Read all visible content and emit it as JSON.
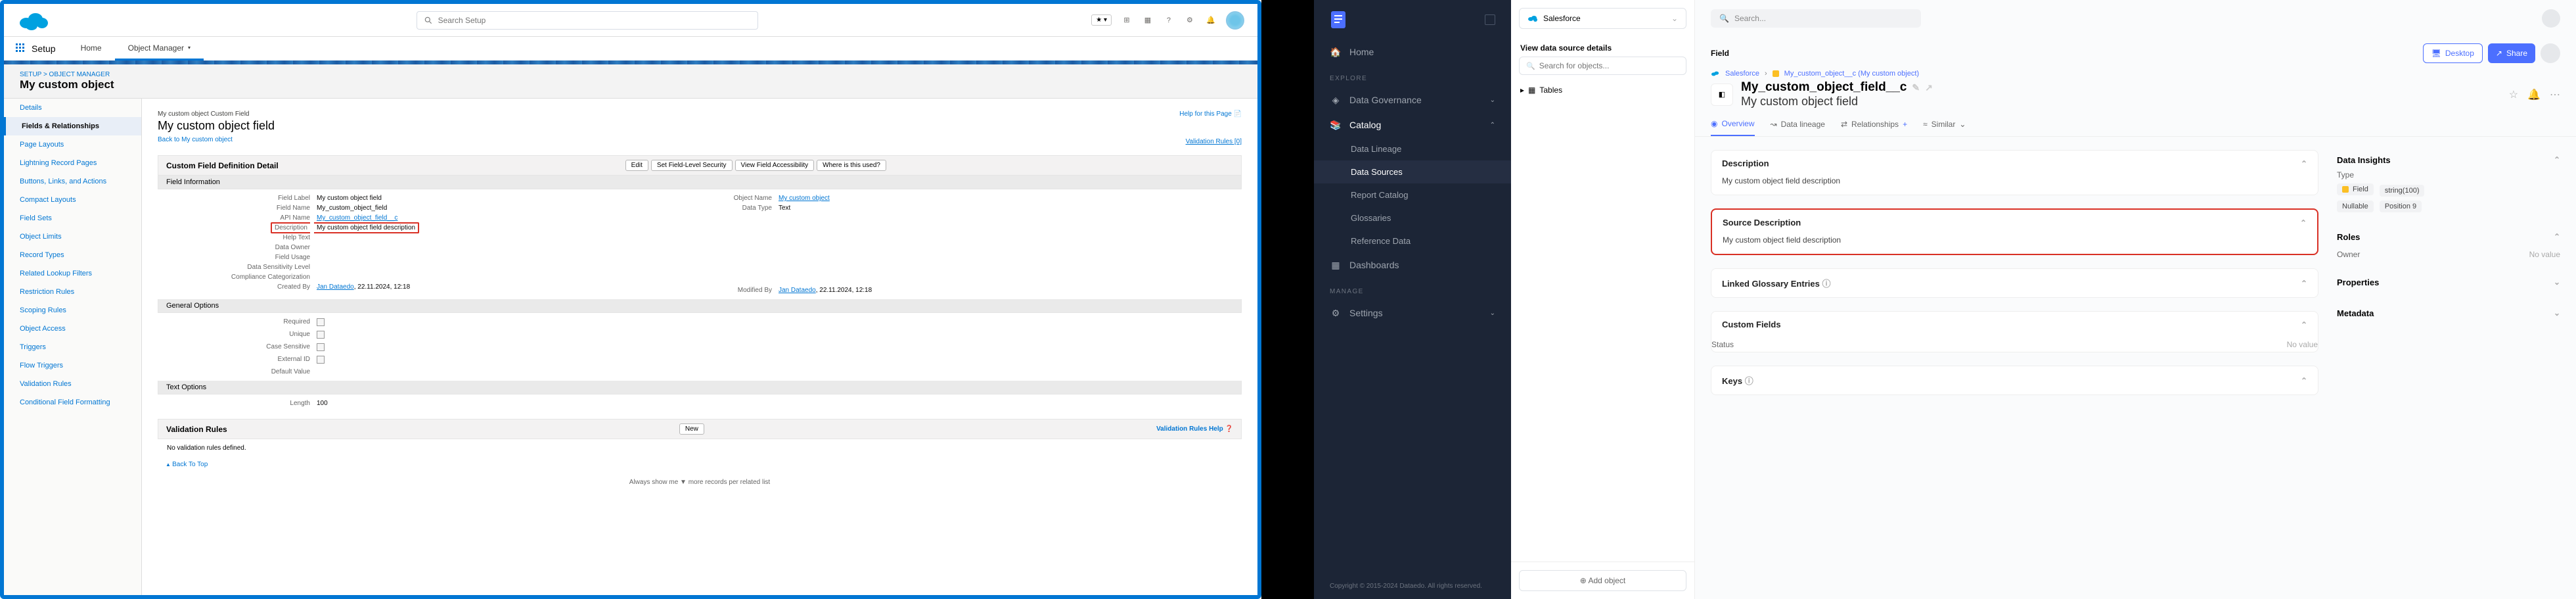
{
  "sf": {
    "search_placeholder": "Search Setup",
    "app_name": "Setup",
    "tab_home": "Home",
    "tab_obj": "Object Manager",
    "crumb": "SETUP  >  OBJECT MANAGER",
    "obj_name": "My custom object",
    "sidebar": [
      "Details",
      "Fields & Relationships",
      "Page Layouts",
      "Lightning Record Pages",
      "Buttons, Links, and Actions",
      "Compact Layouts",
      "Field Sets",
      "Object Limits",
      "Record Types",
      "Related Lookup Filters",
      "Restriction Rules",
      "Scoping Rules",
      "Object Access",
      "Triggers",
      "Flow Triggers",
      "Validation Rules",
      "Conditional Field Formatting"
    ],
    "bread2": "My custom object Custom Field",
    "h1": "My custom object field",
    "back": "Back to My custom object",
    "valid_link": "Validation Rules [0]",
    "help": "Help for this Page",
    "block1_title": "Custom Field Definition Detail",
    "btns": [
      "Edit",
      "Set Field-Level Security",
      "View Field Accessibility",
      "Where is this used?"
    ],
    "sub1": "Field Information",
    "rows_left": {
      "field_label": {
        "lbl": "Field Label",
        "val": "My custom object field"
      },
      "field_name": {
        "lbl": "Field Name",
        "val": "My_custom_object_field"
      },
      "api_name": {
        "lbl": "API Name",
        "val": "My_custom_object_field__c"
      },
      "description": {
        "lbl": "Description",
        "val": "My custom object field description"
      },
      "help_text": {
        "lbl": "Help Text",
        "val": ""
      },
      "data_owner": {
        "lbl": "Data Owner",
        "val": ""
      },
      "field_usage": {
        "lbl": "Field Usage",
        "val": ""
      },
      "data_sens": {
        "lbl": "Data Sensitivity Level",
        "val": ""
      },
      "compliance": {
        "lbl": "Compliance Categorization",
        "val": ""
      },
      "created_by": {
        "lbl": "Created By",
        "val": "Jan Dataedo",
        "date": ", 22.11.2024, 12:18"
      }
    },
    "rows_right": {
      "object_name": {
        "lbl": "Object Name",
        "val": "My custom object"
      },
      "data_type": {
        "lbl": "Data Type",
        "val": "Text"
      },
      "modified_by": {
        "lbl": "Modified By",
        "val": "Jan Dataedo",
        "date": ", 22.11.2024, 12:18"
      }
    },
    "sub2": "General Options",
    "gen_rows": [
      "Required",
      "Unique",
      "Case Sensitive",
      "External ID",
      "Default Value"
    ],
    "sub3": "Text Options",
    "length": {
      "lbl": "Length",
      "val": "100"
    },
    "block2_title": "Validation Rules",
    "btn_new": "New",
    "rules_help": "Validation Rules Help",
    "no_rules": "No validation rules defined.",
    "back_top": "Back To Top",
    "footer_note": "Always show me ▼ more records per related list"
  },
  "de": {
    "home": "Home",
    "sec_explore": "EXPLORE",
    "nav": {
      "data_gov": "Data Governance",
      "catalog": "Catalog",
      "data_lineage": "Data Lineage",
      "data_sources": "Data Sources",
      "report_catalog": "Report Catalog",
      "glossaries": "Glossaries",
      "reference_data": "Reference Data",
      "dashboards": "Dashboards"
    },
    "sec_manage": "MANAGE",
    "settings": "Settings",
    "footer": "Copyright © 2015-2024 Dataedo. All rights reserved.",
    "tree": {
      "source": "Salesforce",
      "sub": "View data source details",
      "search_placeholder": "Search for objects...",
      "item": "Tables"
    },
    "add_obj": "Add object",
    "search_placeholder": "Search...",
    "field_label": "Field",
    "bc_source": "Salesforce",
    "bc_obj": "My_custom_object__c (My custom object)",
    "title_api": "My_custom_object_field__c",
    "title_friendly": "My custom object field",
    "btn_desktop": "Desktop",
    "btn_share": "Share",
    "tabs": {
      "overview": "Overview",
      "lineage": "Data lineage",
      "rel": "Relationships",
      "similar": "Similar"
    },
    "cards": {
      "desc_h": "Description",
      "desc_b": "My custom object field description",
      "src_h": "Source Description",
      "src_b": "My custom object field description",
      "glossary": "Linked Glossary Entries",
      "custom": "Custom Fields",
      "status_lbl": "Status",
      "no_value": "No value",
      "keys": "Keys"
    },
    "right": {
      "insights": "Data Insights",
      "type_lbl": "Type",
      "pill_field": "Field",
      "pill_type": "string(100)",
      "pill_null": "Nullable",
      "pill_pos": "Position 9",
      "roles": "Roles",
      "owner_lbl": "Owner",
      "no_value": "No value",
      "props": "Properties",
      "meta": "Metadata"
    }
  }
}
